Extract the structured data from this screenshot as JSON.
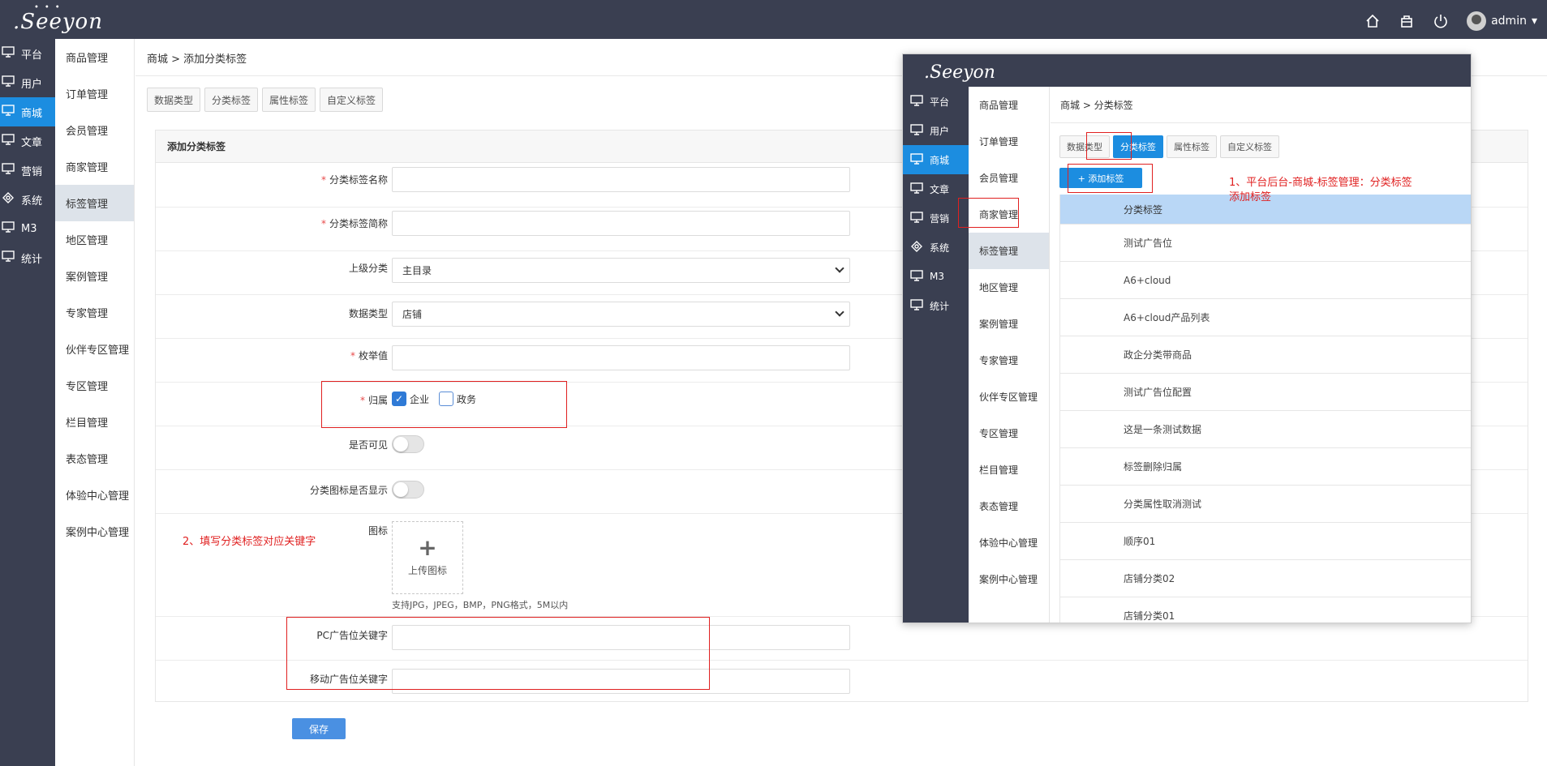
{
  "app": {
    "logo_text": ".Seeyon",
    "user": "admin"
  },
  "nav_primary": [
    {
      "label": "平台",
      "icon": "monitor-icon"
    },
    {
      "label": "用户",
      "icon": "monitor-icon"
    },
    {
      "label": "商城",
      "icon": "monitor-icon",
      "active": true
    },
    {
      "label": "文章",
      "icon": "monitor-icon"
    },
    {
      "label": "营销",
      "icon": "monitor-icon"
    },
    {
      "label": "系统",
      "icon": "settings-icon"
    },
    {
      "label": "M3",
      "icon": "monitor-icon"
    },
    {
      "label": "统计",
      "icon": "monitor-icon"
    }
  ],
  "nav_secondary": [
    "商品管理",
    "订单管理",
    "会员管理",
    "商家管理",
    "标签管理",
    "地区管理",
    "案例管理",
    "专家管理",
    "伙伴专区管理",
    "专区管理",
    "栏目管理",
    "表态管理",
    "体验中心管理",
    "案例中心管理"
  ],
  "breadcrumb": "商城 > 添加分类标签",
  "tabs": [
    "数据类型",
    "分类标签",
    "属性标签",
    "自定义标签"
  ],
  "form": {
    "title": "添加分类标签",
    "name_label": "分类标签名称",
    "short_label": "分类标签简称",
    "parent_label": "上级分类",
    "parent_value": "主目录",
    "datatype_label": "数据类型",
    "datatype_value": "店铺",
    "enum_label": "枚举值",
    "belong_label": "归属",
    "belong_opt1": "企业",
    "belong_opt2": "政务",
    "visible_label": "是否可见",
    "icon_show_label": "分类图标是否显示",
    "icon_label": "图标",
    "upload_label": "上传图标",
    "upload_hint": "支持JPG，JPEG，BMP，PNG格式，5M以内",
    "pc_label": "PC广告位关键字",
    "mobile_label": "移动广告位关键字",
    "save": "保存"
  },
  "annotations": {
    "note1_line1": "1、平台后台-商城-标签管理：分类标签",
    "note1_line2": "添加标签",
    "note2": "2、填写分类标签对应关键字"
  },
  "inset": {
    "breadcrumb": "商城 > 分类标签",
    "add_button": "+ 添加标签",
    "list_header": "分类标签",
    "rows": [
      "测试广告位",
      "A6+cloud",
      "A6+cloud产品列表",
      "政企分类带商品",
      "测试广告位配置",
      "这是一条测试数据",
      "标签删除归属",
      "分类属性取消测试",
      "顺序01",
      "店铺分类02",
      "店铺分类01"
    ]
  },
  "colors": {
    "sidebar": "#3a3f51",
    "accent": "#1c8de0",
    "annotation": "#e02020"
  }
}
